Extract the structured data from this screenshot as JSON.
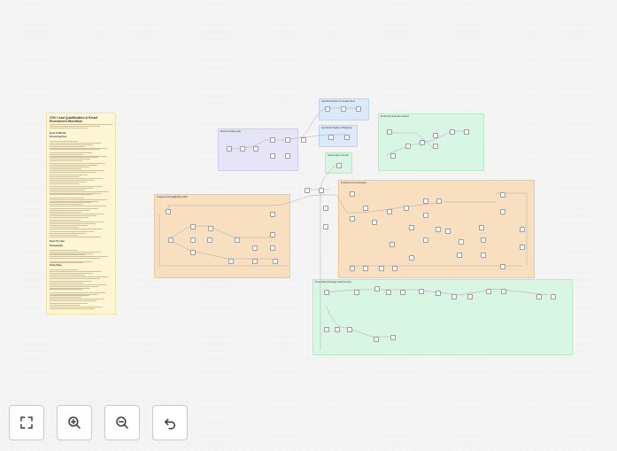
{
  "note": {
    "title": "CSV Lead Qualification & Email Enrichment Workflow",
    "how_it_works": "How It Works",
    "processing_flow": "Processing Flow",
    "how_to_use": "How To Use",
    "prerequisites": "Prerequisites",
    "setup_steps": "Setup Steps"
  },
  "groups": [
    {
      "key": "a",
      "label": "Extract & lookup data"
    },
    {
      "key": "b",
      "label": "Lead Prioritization for Google Sheet"
    },
    {
      "key": "c",
      "label": "Send Email Details to WhatsApp"
    },
    {
      "key": "d",
      "label": "Send email to the user"
    },
    {
      "key": "e",
      "label": "Email body & domain analysis"
    },
    {
      "key": "f",
      "label": "AI agent email qualification batch"
    },
    {
      "key": "g",
      "label": "AI Enrichment and analysis"
    },
    {
      "key": "h",
      "label": "Personalized Message & Mail Sending"
    }
  ],
  "toolbar": {
    "fit": "fit-view",
    "zoom_in": "zoom-in",
    "zoom_out": "zoom-out",
    "undo": "undo"
  },
  "colors": {
    "background": "#f4f4f5",
    "note": "#fff6d6",
    "group_purple": "#e6e5f7",
    "group_blue": "#dbe9fa",
    "group_green": "#d9f5e4",
    "group_orange": "#f8dfbf"
  }
}
